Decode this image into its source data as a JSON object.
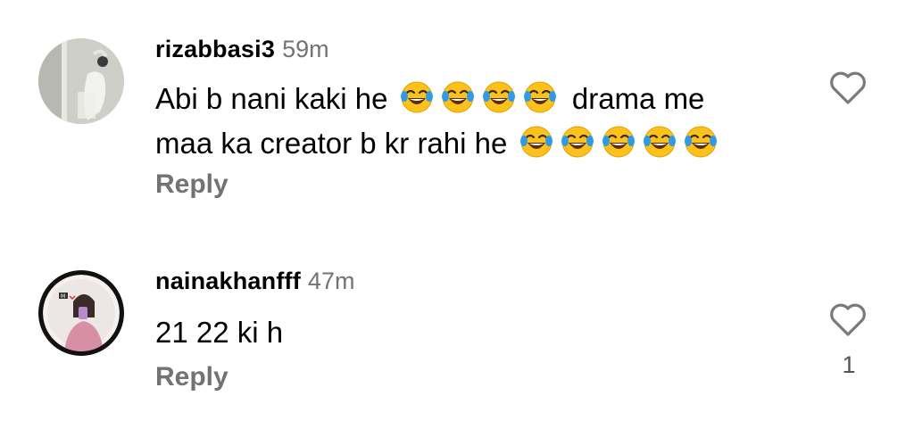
{
  "comments": [
    {
      "username": "rizabbasi3",
      "time": "59m",
      "text_line1": "Abi b nani kaki he",
      "text_line1_tail": "drama me",
      "text_line2": "maa ka creator b kr rahi he",
      "emoji": "face-with-tears-of-joy",
      "reply_label": "Reply",
      "like_icon": "heart-outline-icon"
    },
    {
      "username": "nainakhanfff",
      "time": "47m",
      "text": "21 22 ki h",
      "reply_label": "Reply",
      "like_icon": "heart-outline-icon",
      "like_count": "1"
    }
  ],
  "colors": {
    "username": "#000000",
    "meta_gray": "#737373",
    "emoji_yellow": "#FCC21B",
    "tear_blue": "#2E9BE8"
  }
}
